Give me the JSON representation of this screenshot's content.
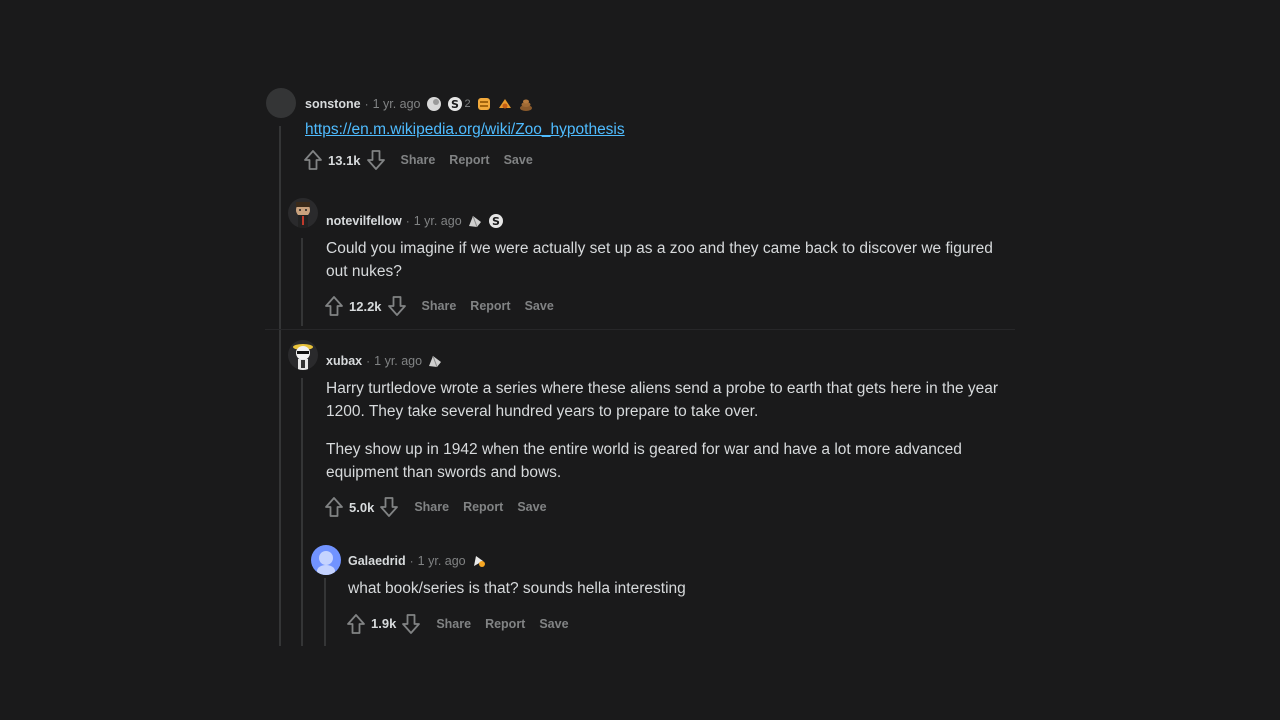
{
  "colors": {
    "background": "#1a1a1b",
    "text": "#d7dadc",
    "meta": "#818384",
    "link": "#4fbcff",
    "thread_line": "#343536"
  },
  "comments": [
    {
      "author": "sonstone",
      "time": "1 yr. ago",
      "award_icons": [
        "silver-award-icon",
        "helpful-award-icon",
        "gold-award-icon",
        "wholesome-award-icon",
        "poop-award-icon"
      ],
      "award_count": "2",
      "link": "https://en.m.wikipedia.org/wiki/Zoo_hypothesis",
      "score": "13.1k",
      "share": "Share",
      "report": "Report",
      "save": "Save"
    },
    {
      "author": "notevilfellow",
      "time": "1 yr. ago",
      "award_icons": [
        "silver-award-icon",
        "helpful-award-icon"
      ],
      "text": [
        "Could you imagine if we were actually set up as a zoo and they came back to discover we figured out nukes?"
      ],
      "score": "12.2k",
      "share": "Share",
      "report": "Report",
      "save": "Save"
    },
    {
      "author": "xubax",
      "time": "1 yr. ago",
      "award_icons": [
        "silver-award-icon"
      ],
      "text": [
        "Harry turtledove wrote a series where these aliens send a probe to earth that gets here in the year 1200. They take several hundred years to prepare to take over.",
        "They show up in 1942 when the entire world is geared for war and have a lot more advanced equipment than swords and bows."
      ],
      "score": "5.0k",
      "share": "Share",
      "report": "Report",
      "save": "Save"
    },
    {
      "author": "Galaedrid",
      "time": "1 yr. ago",
      "award_icons": [
        "bravo-award-icon"
      ],
      "text": [
        "what book/series is that? sounds hella interesting"
      ],
      "score": "1.9k",
      "share": "Share",
      "report": "Report",
      "save": "Save"
    }
  ]
}
